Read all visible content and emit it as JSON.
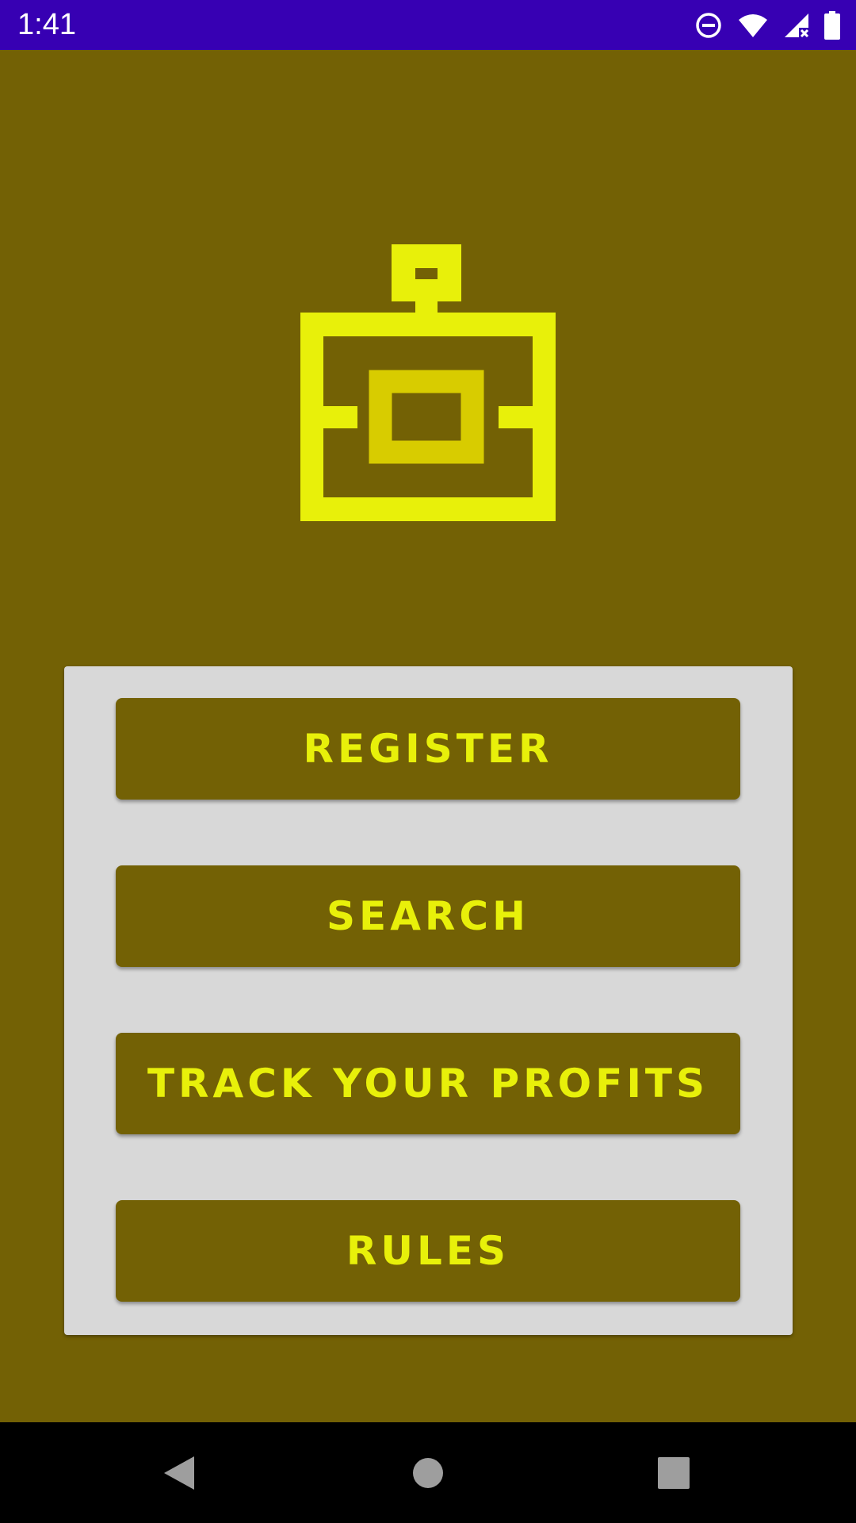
{
  "status_bar": {
    "time": "1:41",
    "icons": [
      "do-not-disturb-icon",
      "wifi-icon",
      "signal-icon",
      "battery-icon"
    ],
    "background_color": "#3700b3"
  },
  "app": {
    "background_color": "#736105",
    "logo_icon": "bottle-chest-logo-icon",
    "accent_color": "#e8f00a"
  },
  "menu": {
    "card_color": "#d8d8d8",
    "buttons": [
      {
        "label": "REGISTER"
      },
      {
        "label": "SEARCH"
      },
      {
        "label": "TRACK YOUR PROFITS"
      },
      {
        "label": "RULES"
      }
    ]
  },
  "nav_bar": {
    "items": [
      "back-icon",
      "home-icon",
      "recents-icon"
    ]
  }
}
